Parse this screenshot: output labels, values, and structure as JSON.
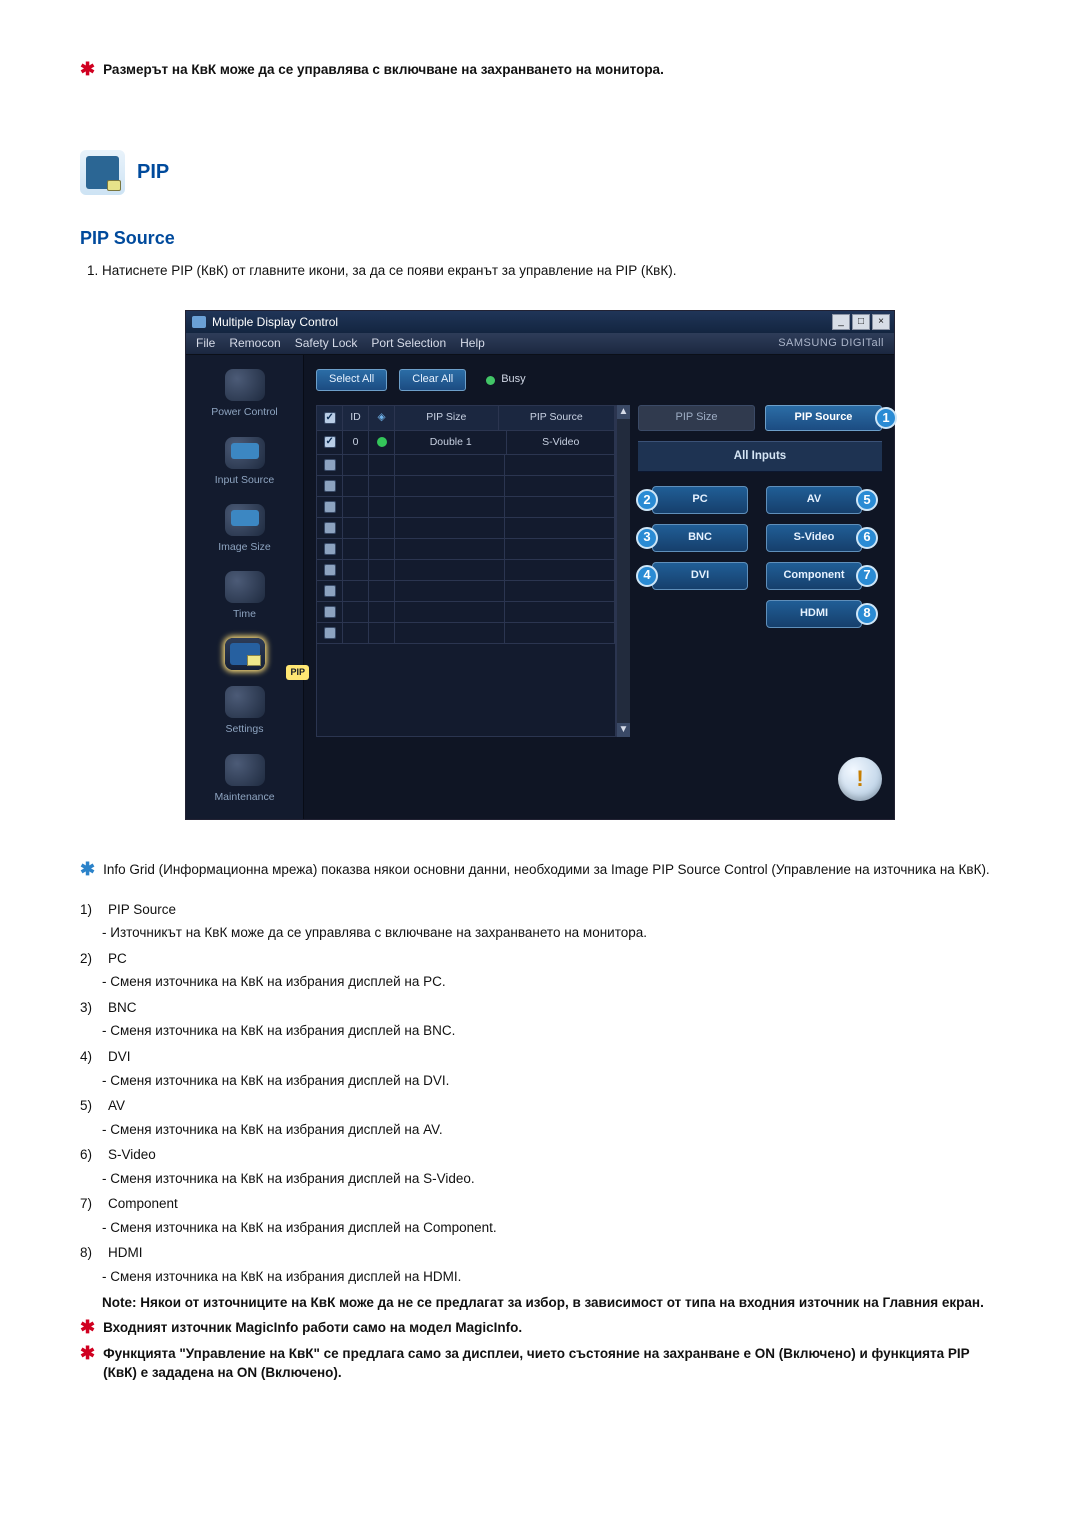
{
  "top_note": "Размерът на КвК може да се управлява с включване на захранването на монитора.",
  "section": {
    "heading": "PIP",
    "subheading": "PIP Source",
    "instruction_1": "Натиснете PIP (КвК) от главните икони, за да се появи екранът за управление на PIP (КвК)."
  },
  "app": {
    "title": "Multiple Display Control",
    "win_min": "_",
    "win_max": "□",
    "win_close": "×",
    "menus": [
      "File",
      "Remocon",
      "Safety Lock",
      "Port Selection",
      "Help"
    ],
    "brand": "SAMSUNG DIGITall",
    "sidebar": [
      {
        "label": "Power Control"
      },
      {
        "label": "Input Source"
      },
      {
        "label": "Image Size"
      },
      {
        "label": "Time"
      },
      {
        "label": "PIP",
        "badge": "PIP"
      },
      {
        "label": "Settings"
      },
      {
        "label": "Maintenance"
      }
    ],
    "select_all": "Select All",
    "clear_all": "Clear All",
    "busy": "Busy",
    "grid_head": {
      "id": "ID",
      "size": "PIP Size",
      "source": "PIP Source"
    },
    "grid_rows": [
      {
        "checked": true,
        "id": "0",
        "size": "Double 1",
        "source": "S-Video"
      }
    ],
    "right": {
      "pip_size": "PIP Size",
      "pip_source": "PIP Source",
      "all_inputs": "All Inputs",
      "inputs": [
        {
          "pos": "left",
          "num": "2",
          "label": "PC"
        },
        {
          "pos": "right",
          "num": "5",
          "label": "AV"
        },
        {
          "pos": "left",
          "num": "3",
          "label": "BNC"
        },
        {
          "pos": "right",
          "num": "6",
          "label": "S-Video"
        },
        {
          "pos": "left",
          "num": "4",
          "label": "DVI"
        },
        {
          "pos": "right",
          "num": "7",
          "label": "Component"
        },
        {
          "pos": "right",
          "num": "8",
          "label": "HDMI"
        }
      ],
      "pip_source_num": "1"
    },
    "bell": "!"
  },
  "info_grid_text": "Info Grid (Информационна мрежа) показва някои основни данни, необходими за Image PIP Source Control (Управление на източника на КвК).",
  "items": [
    {
      "n": "1)",
      "title": "PIP Source",
      "desc": "- Източникът на КвК може да се управлява с включване на захранването на монитора."
    },
    {
      "n": "2)",
      "title": "PC",
      "desc": "- Сменя източника на КвК на избрания дисплей на PC."
    },
    {
      "n": "3)",
      "title": "BNC",
      "desc": "- Сменя източника на КвК на избрания дисплей на BNC."
    },
    {
      "n": "4)",
      "title": "DVI",
      "desc": "- Сменя източника на КвК на избрания дисплей на DVI."
    },
    {
      "n": "5)",
      "title": "AV",
      "desc": "- Сменя източника на КвК на избрания дисплей на AV."
    },
    {
      "n": "6)",
      "title": "S-Video",
      "desc": "- Сменя източника на КвК на избрания дисплей на S-Video."
    },
    {
      "n": "7)",
      "title": "Component",
      "desc": "- Сменя източника на КвК на избрания дисплей на Component."
    },
    {
      "n": "8)",
      "title": "HDMI",
      "desc": "- Сменя източника на КвК на избрания дисплей на HDMI."
    }
  ],
  "note_bold": "Note: Някои от източниците на КвК може да не се предлагат за избор, в зависимост от типа на входния източник на Главния екран.",
  "star1": "Входният източник MagicInfo работи само на модел MagicInfo.",
  "star2": "Функцията \"Управление на КвК\" се предлага само за дисплеи, чието състояние на захранване е ON (Включено) и функцията PIP (КвК) е зададена на ON (Включено)."
}
